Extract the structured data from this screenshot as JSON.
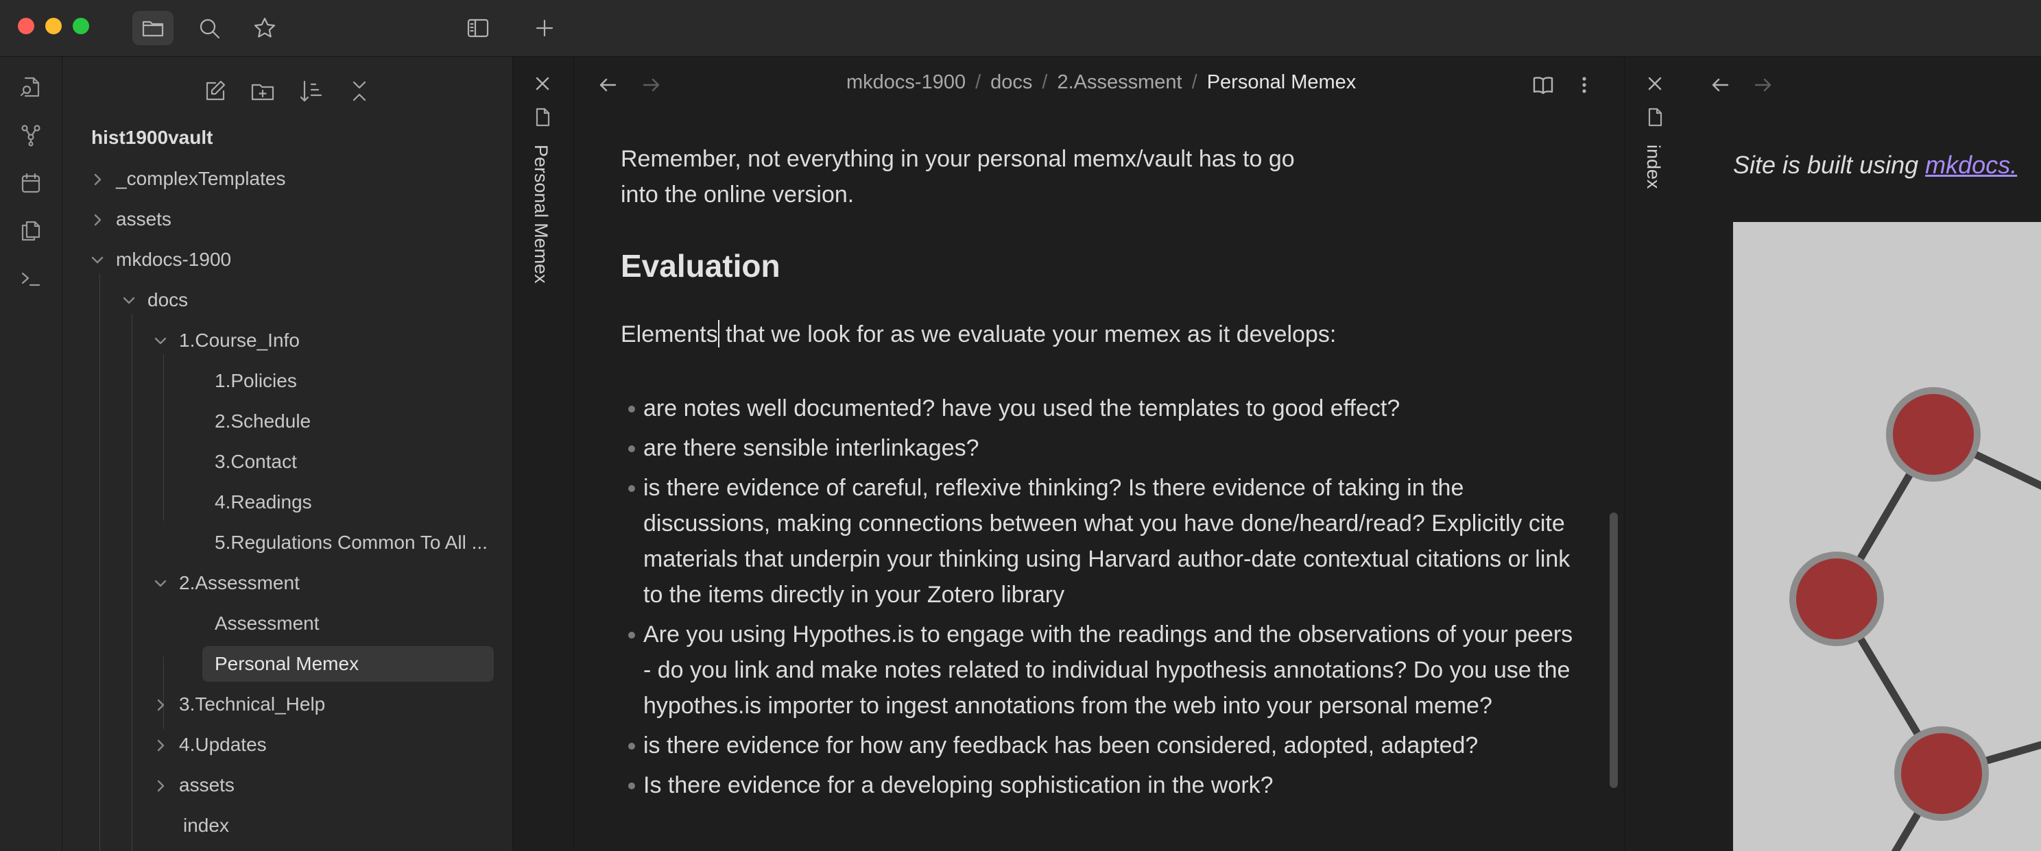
{
  "titlebar": {
    "traffic_colors": {
      "close": "#fe5f57",
      "minimize": "#febc2e",
      "zoom": "#28c840"
    },
    "icons": [
      "folder-icon",
      "search-icon",
      "star-icon",
      "sidebar-toggle-icon",
      "plus-icon"
    ]
  },
  "ribbon": {
    "icons": [
      "quick-switcher-icon",
      "graph-view-icon",
      "calendar-icon",
      "copy-icon",
      "terminal-icon"
    ]
  },
  "sidebar": {
    "toolbar_icons": [
      "new-note-icon",
      "new-folder-icon",
      "sort-icon",
      "collapse-all-icon"
    ],
    "vault_name": "hist1900vault",
    "items": [
      {
        "label": "_complexTemplates",
        "depth": 0,
        "kind": "folder",
        "expanded": false
      },
      {
        "label": "assets",
        "depth": 0,
        "kind": "folder",
        "expanded": false
      },
      {
        "label": "mkdocs-1900",
        "depth": 0,
        "kind": "folder",
        "expanded": true
      },
      {
        "label": "docs",
        "depth": 1,
        "kind": "folder",
        "expanded": true
      },
      {
        "label": "1.Course_Info",
        "depth": 2,
        "kind": "folder",
        "expanded": true
      },
      {
        "label": "1.Policies",
        "depth": 3,
        "kind": "file"
      },
      {
        "label": "2.Schedule",
        "depth": 3,
        "kind": "file"
      },
      {
        "label": "3.Contact",
        "depth": 3,
        "kind": "file"
      },
      {
        "label": "4.Readings",
        "depth": 3,
        "kind": "file"
      },
      {
        "label": "5.Regulations Common To All ...",
        "depth": 3,
        "kind": "file"
      },
      {
        "label": "2.Assessment",
        "depth": 2,
        "kind": "folder",
        "expanded": true
      },
      {
        "label": "Assessment",
        "depth": 3,
        "kind": "file"
      },
      {
        "label": "Personal Memex",
        "depth": 3,
        "kind": "file",
        "selected": true
      },
      {
        "label": "3.Technical_Help",
        "depth": 2,
        "kind": "folder",
        "expanded": false
      },
      {
        "label": "4.Updates",
        "depth": 2,
        "kind": "folder",
        "expanded": false
      },
      {
        "label": "assets",
        "depth": 2,
        "kind": "folder",
        "expanded": false
      },
      {
        "label": "index",
        "depth": 2,
        "kind": "file"
      }
    ]
  },
  "left_strip": {
    "tab_label": "Personal Memex"
  },
  "main": {
    "breadcrumb": {
      "parts": [
        "mkdocs-1900",
        "docs",
        "2.Assessment"
      ],
      "current": "Personal Memex",
      "separator": "/"
    },
    "intro": "Remember, not everything in your personal memx/vault has to go into the online version.",
    "heading": "Evaluation",
    "lead_before_cursor": "Elements",
    "lead_after_cursor": " that we look for as we evaluate your memex as it develops:",
    "bullets": [
      "are notes well documented? have you used the templates to good effect?",
      "are there sensible interlinkages?",
      "is there evidence of careful, reflexive thinking? Is there evidence of taking in the discussions, making connections between what you have done/heard/read? Explicitly cite materials that underpin your thinking using Harvard author-date contextual citations or link to the items directly in your Zotero library",
      "Are you using Hypothes.is to engage with the readings and the observations of your peers - do you link and make notes related to individual hypothesis annotations? Do you use the hypothes.is importer to ingest annotations from the web into your personal meme?",
      "is there evidence for how any feedback has been considered, adopted, adapted?",
      "Is there evidence for a developing sophistication in the work?"
    ]
  },
  "right_strip": {
    "tab_label": "index"
  },
  "right_pane": {
    "text_before": "Site is built using ",
    "link": "mkdocs.",
    "link_color": "#a78bfa",
    "graph_node_color": "#9b3535"
  }
}
